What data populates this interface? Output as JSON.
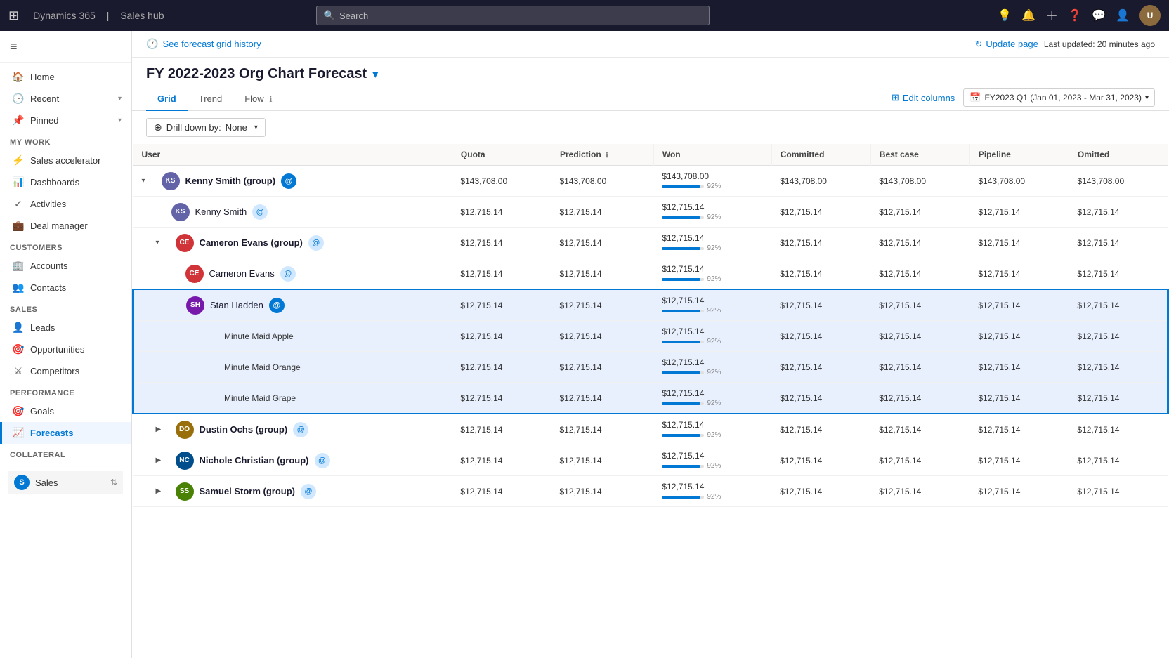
{
  "topnav": {
    "app_name": "Dynamics 365",
    "separator": "|",
    "hub_name": "Sales hub",
    "search_placeholder": "Search",
    "icons": {
      "lightbulb": "💡",
      "bell": "🔔",
      "plus": "+",
      "help": "?",
      "chat": "💬",
      "person": "👤"
    },
    "avatar_initials": "U"
  },
  "sidebar": {
    "hamburger": "≡",
    "nav_items": [
      {
        "id": "home",
        "label": "Home",
        "icon": "🏠"
      },
      {
        "id": "recent",
        "label": "Recent",
        "icon": "🕒",
        "chevron": "▾"
      },
      {
        "id": "pinned",
        "label": "Pinned",
        "icon": "📌",
        "chevron": "▾"
      }
    ],
    "my_work_label": "My work",
    "my_work_items": [
      {
        "id": "sales-accelerator",
        "label": "Sales accelerator",
        "icon": "⚡"
      },
      {
        "id": "dashboards",
        "label": "Dashboards",
        "icon": "📊"
      },
      {
        "id": "activities",
        "label": "Activities",
        "icon": "✓"
      },
      {
        "id": "deal-manager",
        "label": "Deal manager",
        "icon": "💼"
      }
    ],
    "customers_label": "Customers",
    "customers_items": [
      {
        "id": "accounts",
        "label": "Accounts",
        "icon": "🏢"
      },
      {
        "id": "contacts",
        "label": "Contacts",
        "icon": "👥"
      }
    ],
    "sales_label": "Sales",
    "sales_items": [
      {
        "id": "leads",
        "label": "Leads",
        "icon": "👤"
      },
      {
        "id": "opportunities",
        "label": "Opportunities",
        "icon": "🎯"
      },
      {
        "id": "competitors",
        "label": "Competitors",
        "icon": "⚔"
      }
    ],
    "performance_label": "Performance",
    "performance_items": [
      {
        "id": "goals",
        "label": "Goals",
        "icon": "🎯"
      },
      {
        "id": "forecasts",
        "label": "Forecasts",
        "icon": "📈",
        "active": true
      }
    ],
    "collateral_label": "Collateral",
    "bottom_group": {
      "label": "Sales",
      "initials": "S",
      "color": "#0078d4"
    }
  },
  "forecast": {
    "history_label": "See forecast grid history",
    "update_page_label": "Update page",
    "last_updated": "Last updated: 20 minutes ago",
    "title": "FY 2022-2023 Org Chart Forecast",
    "tabs": [
      {
        "id": "grid",
        "label": "Grid",
        "active": true
      },
      {
        "id": "trend",
        "label": "Trend"
      },
      {
        "id": "flow",
        "label": "Flow",
        "has_info": true
      }
    ],
    "edit_columns_label": "Edit columns",
    "period_label": "FY2023 Q1 (Jan 01, 2023 - Mar 31, 2023)",
    "drill_down_label": "Drill down by:",
    "drill_down_value": "None",
    "columns": [
      "User",
      "Quota",
      "Prediction",
      "Won",
      "Committed",
      "Best case",
      "Pipeline",
      "Omitted"
    ],
    "rows": [
      {
        "id": "kenny-smith-group",
        "indent": 0,
        "expand": true,
        "avatar": "KS",
        "avatar_color": "#6264a7",
        "name": "Kenny Smith (group)",
        "is_group": true,
        "icon_type": "blue",
        "quota": "$143,708.00",
        "prediction": "$143,708.00",
        "won": "$143,708.00",
        "won_pct": 92,
        "committed": "$143,708.00",
        "best_case": "$143,708.00",
        "pipeline": "$143,708.00",
        "omitted": "$143,708.00"
      },
      {
        "id": "kenny-smith",
        "indent": 1,
        "expand": false,
        "avatar": "KS",
        "avatar_color": "#6264a7",
        "name": "Kenny Smith",
        "is_group": false,
        "icon_type": "light",
        "quota": "$12,715.14",
        "prediction": "$12,715.14",
        "won": "$12,715.14",
        "won_pct": 92,
        "committed": "$12,715.14",
        "best_case": "$12,715.14",
        "pipeline": "$12,715.14",
        "omitted": "$12,715.14"
      },
      {
        "id": "cameron-evans-group",
        "indent": 1,
        "expand": true,
        "avatar": "CE",
        "avatar_color": "#d13438",
        "name": "Cameron Evans (group)",
        "is_group": true,
        "icon_type": "light",
        "quota": "$12,715.14",
        "prediction": "$12,715.14",
        "won": "$12,715.14",
        "won_pct": 92,
        "committed": "$12,715.14",
        "best_case": "$12,715.14",
        "pipeline": "$12,715.14",
        "omitted": "$12,715.14"
      },
      {
        "id": "cameron-evans",
        "indent": 2,
        "expand": false,
        "avatar": "CE",
        "avatar_color": "#d13438",
        "name": "Cameron Evans",
        "is_group": false,
        "icon_type": "light",
        "quota": "$12,715.14",
        "prediction": "$12,715.14",
        "won": "$12,715.14",
        "won_pct": 92,
        "committed": "$12,715.14",
        "best_case": "$12,715.14",
        "pipeline": "$12,715.14",
        "omitted": "$12,715.14"
      },
      {
        "id": "stan-hadden",
        "indent": 2,
        "expand": false,
        "avatar": "SH",
        "avatar_color": "#7719aa",
        "name": "Stan Hadden",
        "is_group": false,
        "icon_type": "blue",
        "quota": "$12,715.14",
        "prediction": "$12,715.14",
        "won": "$12,715.14",
        "won_pct": 92,
        "committed": "$12,715.14",
        "best_case": "$12,715.14",
        "pipeline": "$12,715.14",
        "omitted": "$12,715.14",
        "selected": true,
        "selected_top": true
      },
      {
        "id": "minute-maid-apple",
        "indent": 3,
        "expand": false,
        "avatar": null,
        "name": "Minute Maid Apple",
        "is_group": false,
        "icon_type": null,
        "quota": "$12,715.14",
        "prediction": "$12,715.14",
        "won": "$12,715.14",
        "won_pct": 92,
        "committed": "$12,715.14",
        "best_case": "$12,715.14",
        "pipeline": "$12,715.14",
        "omitted": "$12,715.14",
        "selected": true
      },
      {
        "id": "minute-maid-orange",
        "indent": 3,
        "expand": false,
        "avatar": null,
        "name": "Minute Maid Orange",
        "is_group": false,
        "icon_type": null,
        "quota": "$12,715.14",
        "prediction": "$12,715.14",
        "won": "$12,715.14",
        "won_pct": 92,
        "committed": "$12,715.14",
        "best_case": "$12,715.14",
        "pipeline": "$12,715.14",
        "omitted": "$12,715.14",
        "selected": true
      },
      {
        "id": "minute-maid-grape",
        "indent": 3,
        "expand": false,
        "avatar": null,
        "name": "Minute Maid Grape",
        "is_group": false,
        "icon_type": null,
        "quota": "$12,715.14",
        "prediction": "$12,715.14",
        "won": "$12,715.14",
        "won_pct": 92,
        "committed": "$12,715.14",
        "best_case": "$12,715.14",
        "pipeline": "$12,715.14",
        "omitted": "$12,715.14",
        "selected": true,
        "selected_bottom": true
      },
      {
        "id": "dustin-ochs-group",
        "indent": 1,
        "expand": false,
        "avatar": "DO",
        "avatar_color": "#986f0b",
        "name": "Dustin Ochs (group)",
        "is_group": true,
        "icon_type": "light",
        "quota": "$12,715.14",
        "prediction": "$12,715.14",
        "won": "$12,715.14",
        "won_pct": 92,
        "committed": "$12,715.14",
        "best_case": "$12,715.14",
        "pipeline": "$12,715.14",
        "omitted": "$12,715.14"
      },
      {
        "id": "nichole-christian-group",
        "indent": 1,
        "expand": false,
        "avatar": "NC",
        "avatar_color": "#004e8c",
        "name": "Nichole Christian (group)",
        "is_group": true,
        "icon_type": "light",
        "quota": "$12,715.14",
        "prediction": "$12,715.14",
        "won": "$12,715.14",
        "won_pct": 92,
        "committed": "$12,715.14",
        "best_case": "$12,715.14",
        "pipeline": "$12,715.14",
        "omitted": "$12,715.14"
      },
      {
        "id": "samuel-storm-group",
        "indent": 1,
        "expand": false,
        "avatar": "SS",
        "avatar_color": "#498205",
        "name": "Samuel Storm (group)",
        "is_group": true,
        "icon_type": "light",
        "quota": "$12,715.14",
        "prediction": "$12,715.14",
        "won": "$12,715.14",
        "won_pct": 92,
        "committed": "$12,715.14",
        "best_case": "$12,715.14",
        "pipeline": "$12,715.14",
        "omitted": "$12,715.14"
      }
    ]
  }
}
